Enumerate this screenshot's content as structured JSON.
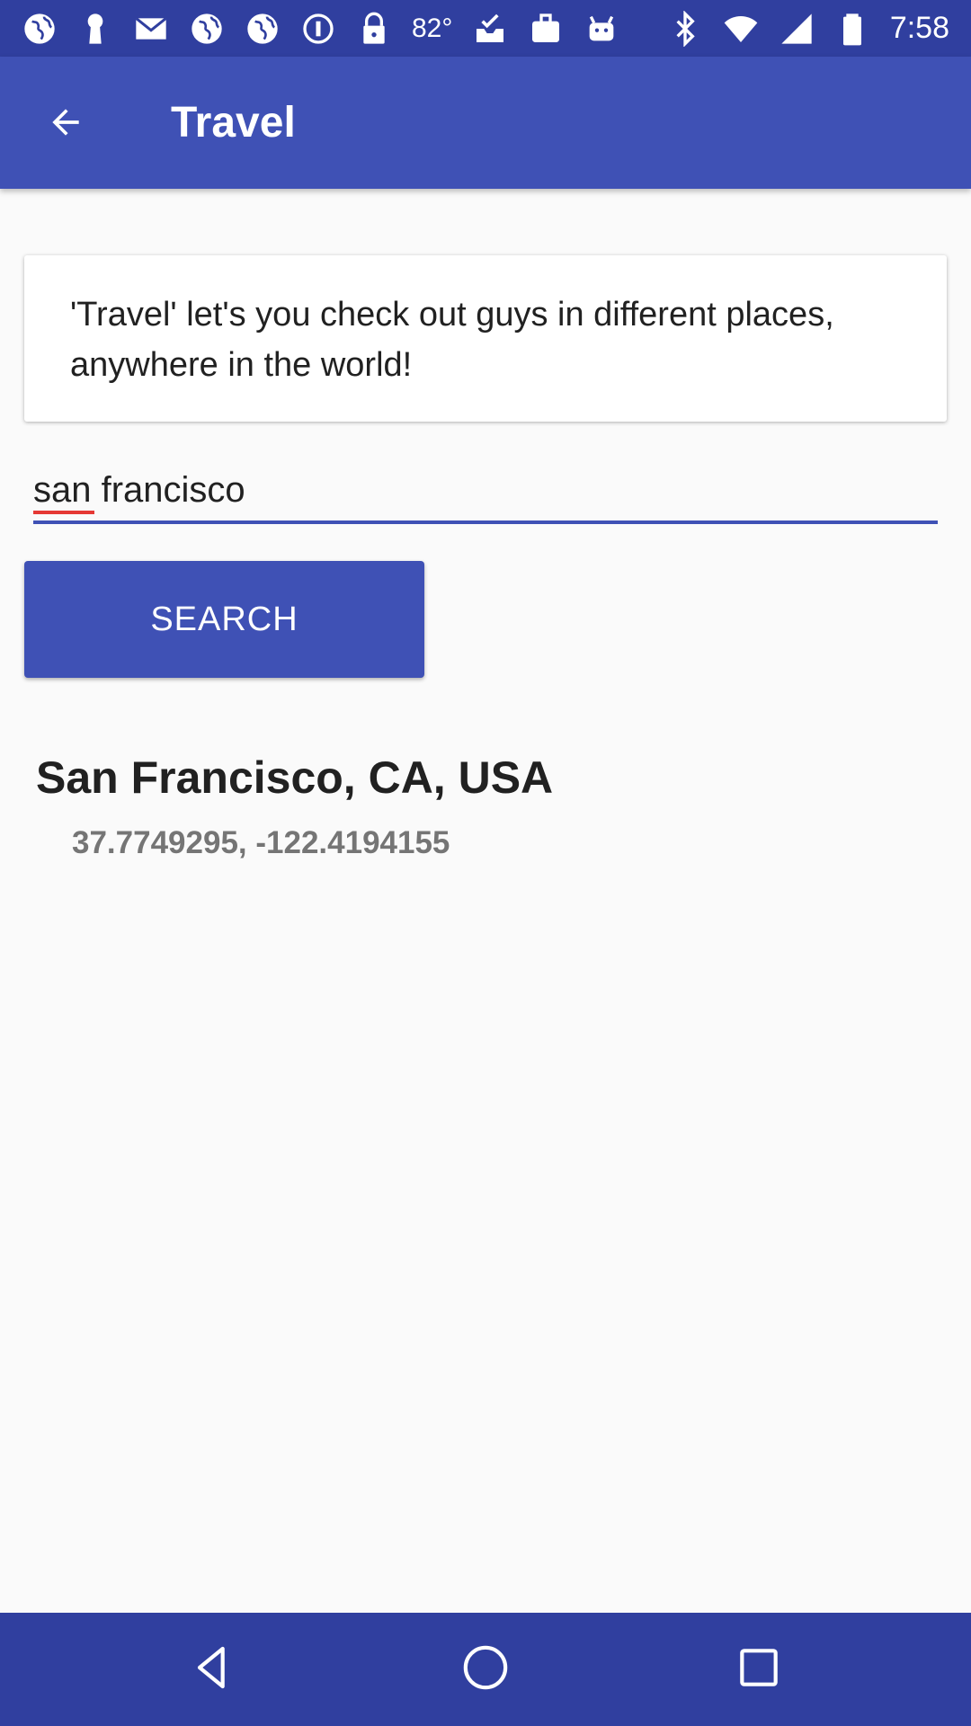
{
  "status_bar": {
    "temperature": "82°",
    "time": "7:58",
    "left_icons": [
      "globe-icon",
      "keyhole-icon",
      "mail-icon",
      "globe-icon",
      "globe-icon",
      "info-circle-icon",
      "lock-icon"
    ],
    "right_icons": [
      "bluetooth-icon",
      "wifi-icon",
      "cellular-icon",
      "battery-icon"
    ]
  },
  "app_bar": {
    "title": "Travel",
    "back_icon": "arrow-back-icon"
  },
  "intro_card": {
    "text": "'Travel' let's you check out guys in different places, anywhere in the world!"
  },
  "search": {
    "value": "san francisco",
    "button_label": "SEARCH"
  },
  "result": {
    "title": "San Francisco, CA, USA",
    "coordinates": "37.7749295, -122.4194155"
  },
  "nav_bar": {
    "back": "back-triangle-icon",
    "home": "home-circle-icon",
    "recents": "recents-square-icon"
  },
  "colors": {
    "primary": "#3f51b5",
    "primary_dark": "#303f9f",
    "background": "#fafafa"
  }
}
